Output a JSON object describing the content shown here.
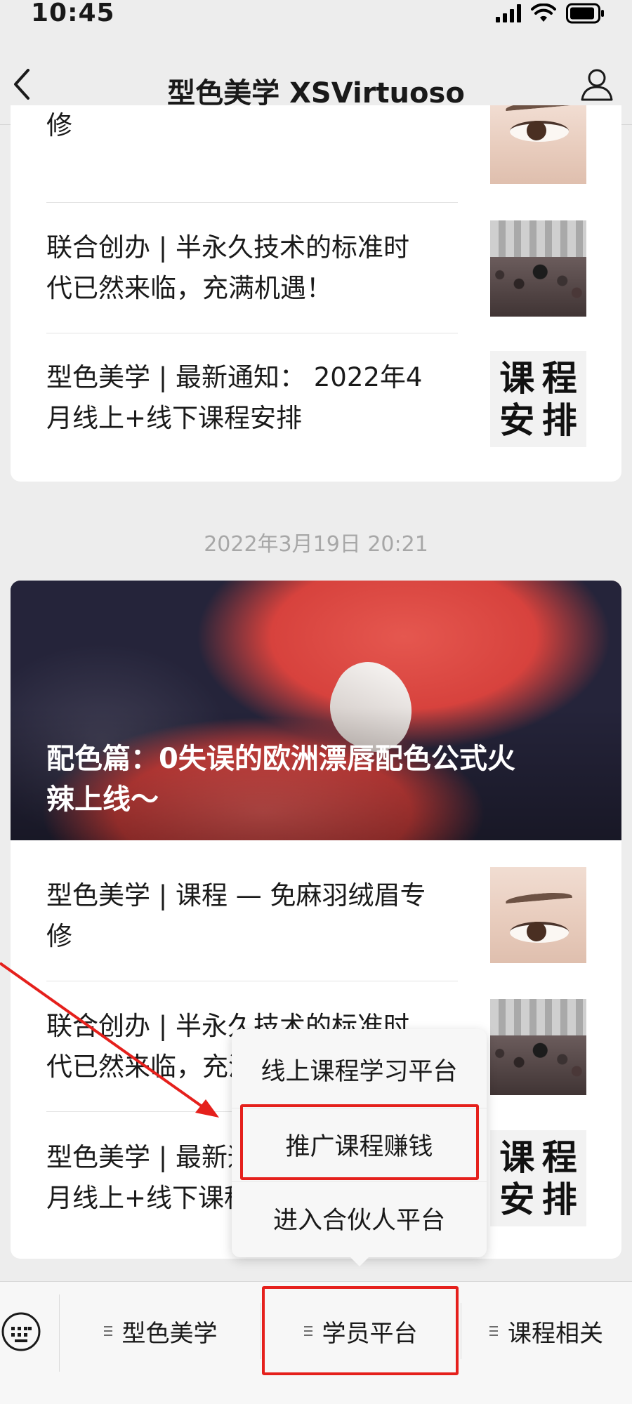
{
  "status_bar": {
    "time": "10:45"
  },
  "nav": {
    "title": "型色美学 XSVirtuoso"
  },
  "card1": {
    "partial_title_tail": "修",
    "articles": [
      {
        "title_line1": "联合创办 | 半永久技术的标准时",
        "title_line2": "代已然来临，充满机遇！"
      },
      {
        "title_line1": "型色美学 | 最新通知： 2022年4",
        "title_line2": "月线上+线下课程安排"
      }
    ]
  },
  "date_label": "2022年3月19日 20:21",
  "card2": {
    "cover_title_line1": "配色篇：0失误的欧洲漂唇配色公式火",
    "cover_title_line2": "辣上线～",
    "articles": [
      {
        "title_line1": "型色美学 | 课程 — 免麻羽绒眉专",
        "title_line2": "修"
      },
      {
        "title_line1": "联合创办 | 半永久技术的标准时",
        "title_line2": "代已然来临，充满机遇！"
      },
      {
        "title_line1": "型色美学 | 最新通知： 2022年4",
        "title_line2": "月线上+线下课程安排"
      }
    ]
  },
  "thumb_text": [
    "课",
    "程",
    "安",
    "排"
  ],
  "popup_menu": {
    "items": [
      "线上课程学习平台",
      "推广课程赚钱",
      "进入合伙人平台"
    ]
  },
  "bottom_menu": {
    "tabs": [
      "型色美学",
      "学员平台",
      "课程相关"
    ]
  },
  "colors": {
    "highlight": "#e5201c",
    "background": "#ededed"
  }
}
